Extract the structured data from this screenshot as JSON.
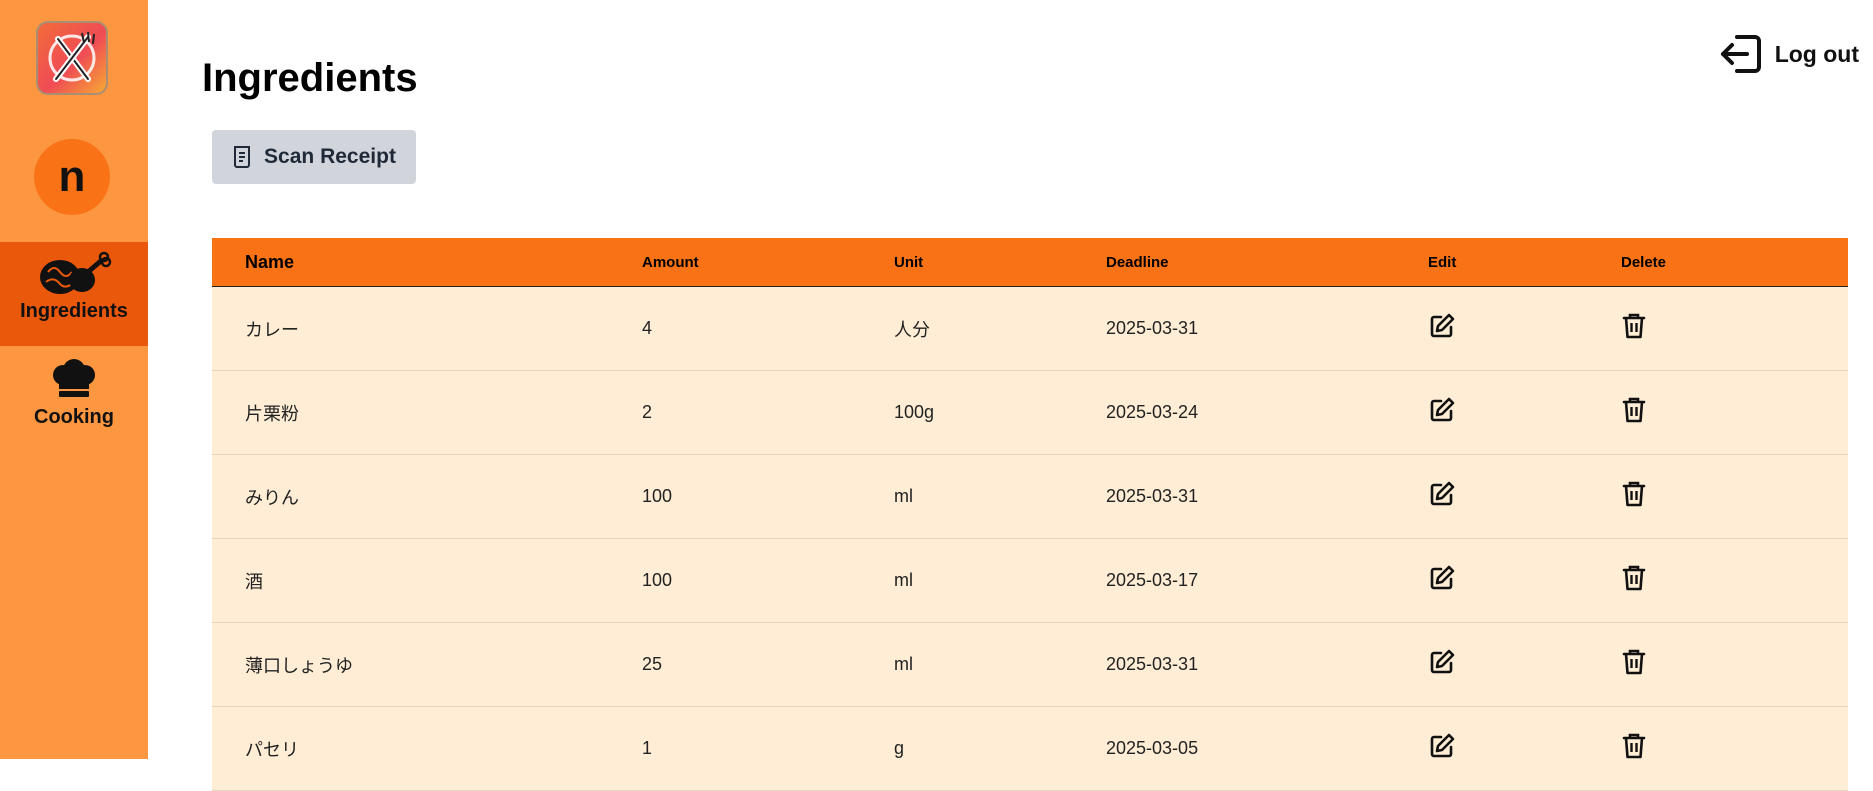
{
  "app": {
    "logo_icon": "fork-knife-logo-icon",
    "user_initial": "n"
  },
  "sidebar": {
    "items": [
      {
        "label": "Ingredients",
        "icon": "meat-drumstick-icon",
        "active": true
      },
      {
        "label": "Cooking",
        "icon": "chef-hat-icon",
        "active": false
      }
    ]
  },
  "header": {
    "title": "Ingredients",
    "logout_label": "Log out",
    "logout_icon": "logout-icon"
  },
  "actions": {
    "scan_label": "Scan Receipt",
    "scan_icon": "receipt-icon"
  },
  "table": {
    "columns": [
      "Name",
      "Amount",
      "Unit",
      "Deadline",
      "Edit",
      "Delete"
    ],
    "rows": [
      {
        "name": "カレー",
        "amount": "4",
        "unit": "人分",
        "deadline": "2025-03-31"
      },
      {
        "name": "片栗粉",
        "amount": "2",
        "unit": "100g",
        "deadline": "2025-03-24"
      },
      {
        "name": "みりん",
        "amount": "100",
        "unit": "ml",
        "deadline": "2025-03-31"
      },
      {
        "name": "酒",
        "amount": "100",
        "unit": "ml",
        "deadline": "2025-03-17"
      },
      {
        "name": "薄口しょうゆ",
        "amount": "25",
        "unit": "ml",
        "deadline": "2025-03-31"
      },
      {
        "name": "パセリ",
        "amount": "1",
        "unit": "g",
        "deadline": "2025-03-05"
      }
    ]
  },
  "colors": {
    "sidebar_bg": "#fd9640",
    "sidebar_active": "#ea580c",
    "table_header": "#f97316",
    "row_bg": "#ffedd5",
    "button_bg": "#d1d5db"
  }
}
